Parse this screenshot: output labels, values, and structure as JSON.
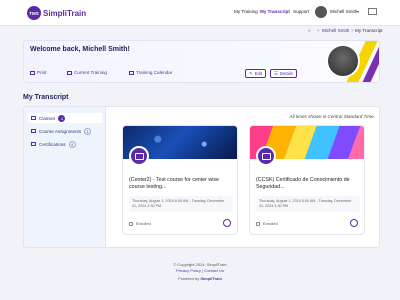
{
  "app": {
    "logo_badge": "TMS",
    "logo_text": "SimpliTrain"
  },
  "nav": {
    "my_training": "My Training",
    "my_transcript": "My Transcript",
    "support": "Support",
    "user_name": "Michell Smith"
  },
  "breadcrumb": {
    "user": "Michell Smith",
    "current": "My Transcript"
  },
  "welcome": {
    "title": "Welcome back, Michell Smith!",
    "links": [
      "Print",
      "Current Training",
      "Training Calendar"
    ],
    "edit": "Edit",
    "details": "Details"
  },
  "transcript": {
    "title": "My Transcript",
    "timezone_note": "All times shown in Central Standard Time.",
    "sidebar": [
      {
        "label": "Classes",
        "count": "4"
      },
      {
        "label": "Course Assignments",
        "count": "1"
      },
      {
        "label": "Certifications",
        "count": "4"
      }
    ],
    "cards": [
      {
        "title": "(Center2) - Test course for center wise course testing...",
        "date": "Thursday, August 1, 2024 8:00 AM - Tuesday, December 31, 2024 4:30 PM",
        "status": "Enrolled"
      },
      {
        "title": "(CCSK) Certificado de Conocimiento de Seguridad...",
        "date": "Thursday, August 1, 2024 8:00 AM - Tuesday, December 31, 2024 4:30 PM",
        "status": "Enrolled"
      }
    ]
  },
  "footer": {
    "copyright": "© Copyright 2024. SimpliTrain",
    "privacy": "Privacy Policy",
    "contact": "Contact Us",
    "powered_prefix": "Powered by",
    "powered_brand": "SimpliTrain"
  },
  "colors": {
    "brand": "#5a2aa8",
    "accent_yellow": "#f6d400",
    "sidebar_bg": "#eef4fb"
  }
}
